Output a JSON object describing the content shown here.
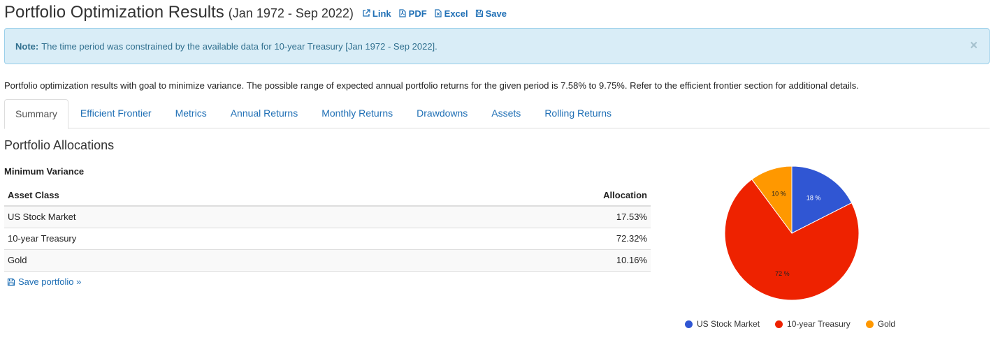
{
  "header": {
    "title": "Portfolio Optimization Results",
    "period": "(Jan 1972 - Sep 2022)",
    "links": [
      {
        "label": "Link",
        "icon": "external-link-icon"
      },
      {
        "label": "PDF",
        "icon": "pdf-file-icon"
      },
      {
        "label": "Excel",
        "icon": "excel-file-icon"
      },
      {
        "label": "Save",
        "icon": "floppy-disk-icon"
      }
    ]
  },
  "note": {
    "label": "Note:",
    "text": "The time period was constrained by the available data for 10-year Treasury [Jan 1972 - Sep 2022].",
    "close": "×"
  },
  "description": "Portfolio optimization results with goal to minimize variance. The possible range of expected annual portfolio returns for the given period is 7.58% to 9.75%. Refer to the efficient frontier section for additional details.",
  "tabs": [
    "Summary",
    "Efficient Frontier",
    "Metrics",
    "Annual Returns",
    "Monthly Returns",
    "Drawdowns",
    "Assets",
    "Rolling Returns"
  ],
  "active_tab": "Summary",
  "allocations": {
    "section_title": "Portfolio Allocations",
    "subtitle": "Minimum Variance",
    "columns": [
      "Asset Class",
      "Allocation"
    ],
    "rows": [
      {
        "asset": "US Stock Market",
        "allocation": "17.53%"
      },
      {
        "asset": "10-year Treasury",
        "allocation": "72.32%"
      },
      {
        "asset": "Gold",
        "allocation": "10.16%"
      }
    ],
    "save_link": "Save portfolio »"
  },
  "colors": {
    "us_stock": "#3056d3",
    "treasury": "#ee2200",
    "gold": "#ff9800",
    "link": "#1f6fb5"
  },
  "chart_data": {
    "type": "pie",
    "categories": [
      "US Stock Market",
      "10-year Treasury",
      "Gold"
    ],
    "values": [
      17.53,
      72.32,
      10.16
    ],
    "labels": [
      "18 %",
      "72 %",
      "10 %"
    ],
    "colors": [
      "#3056d3",
      "#ee2200",
      "#ff9800"
    ],
    "legend_position": "bottom"
  }
}
